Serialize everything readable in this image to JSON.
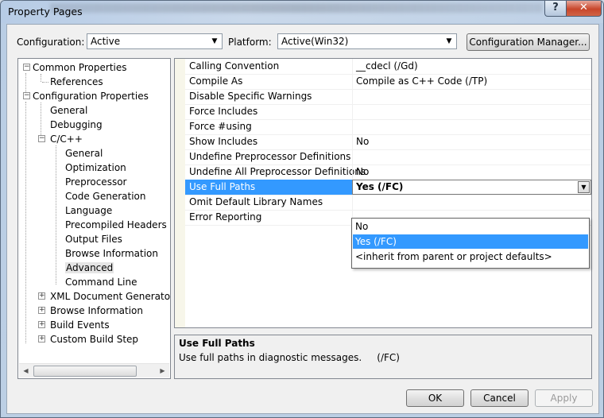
{
  "window": {
    "title": "Property Pages",
    "help_label": "?",
    "close_label": "✕"
  },
  "toolbar": {
    "configuration_label": "Configuration:",
    "configuration_value": "Active",
    "platform_label": "Platform:",
    "platform_value": "Active(Win32)",
    "config_manager_label": "Configuration Manager..."
  },
  "tree": {
    "items": [
      {
        "label": "Common Properties",
        "expander": "−"
      },
      {
        "label": "References"
      },
      {
        "label": "Configuration Properties",
        "expander": "−"
      },
      {
        "label": "General"
      },
      {
        "label": "Debugging"
      },
      {
        "label": "C/C++",
        "expander": "−"
      },
      {
        "label": "General"
      },
      {
        "label": "Optimization"
      },
      {
        "label": "Preprocessor"
      },
      {
        "label": "Code Generation"
      },
      {
        "label": "Language"
      },
      {
        "label": "Precompiled Headers"
      },
      {
        "label": "Output Files"
      },
      {
        "label": "Browse Information"
      },
      {
        "label": "Advanced",
        "selected": true
      },
      {
        "label": "Command Line"
      },
      {
        "label": "XML Document Generator",
        "expander": "+"
      },
      {
        "label": "Browse Information",
        "expander": "+"
      },
      {
        "label": "Build Events",
        "expander": "+"
      },
      {
        "label": "Custom Build Step",
        "expander": "+"
      }
    ]
  },
  "grid": {
    "rows": [
      {
        "name": "Calling Convention",
        "value": "__cdecl (/Gd)"
      },
      {
        "name": "Compile As",
        "value": "Compile as C++ Code (/TP)"
      },
      {
        "name": "Disable Specific Warnings",
        "value": ""
      },
      {
        "name": "Force Includes",
        "value": ""
      },
      {
        "name": "Force #using",
        "value": ""
      },
      {
        "name": "Show Includes",
        "value": "No"
      },
      {
        "name": "Undefine Preprocessor Definitions",
        "value": ""
      },
      {
        "name": "Undefine All Preprocessor Definitions",
        "value": "No"
      },
      {
        "name": "Use Full Paths",
        "value": "Yes (/FC)",
        "selected": true
      },
      {
        "name": "Omit Default Library Names",
        "value": ""
      },
      {
        "name": "Error Reporting",
        "value": ""
      }
    ],
    "dropdown_options": [
      "No",
      "Yes (/FC)",
      "<inherit from parent or project defaults>"
    ],
    "dropdown_highlighted": 1
  },
  "description": {
    "title": "Use Full Paths",
    "text": "Use full paths in diagnostic messages.     (/FC)"
  },
  "buttons": {
    "ok": "OK",
    "cancel": "Cancel",
    "apply": "Apply"
  }
}
